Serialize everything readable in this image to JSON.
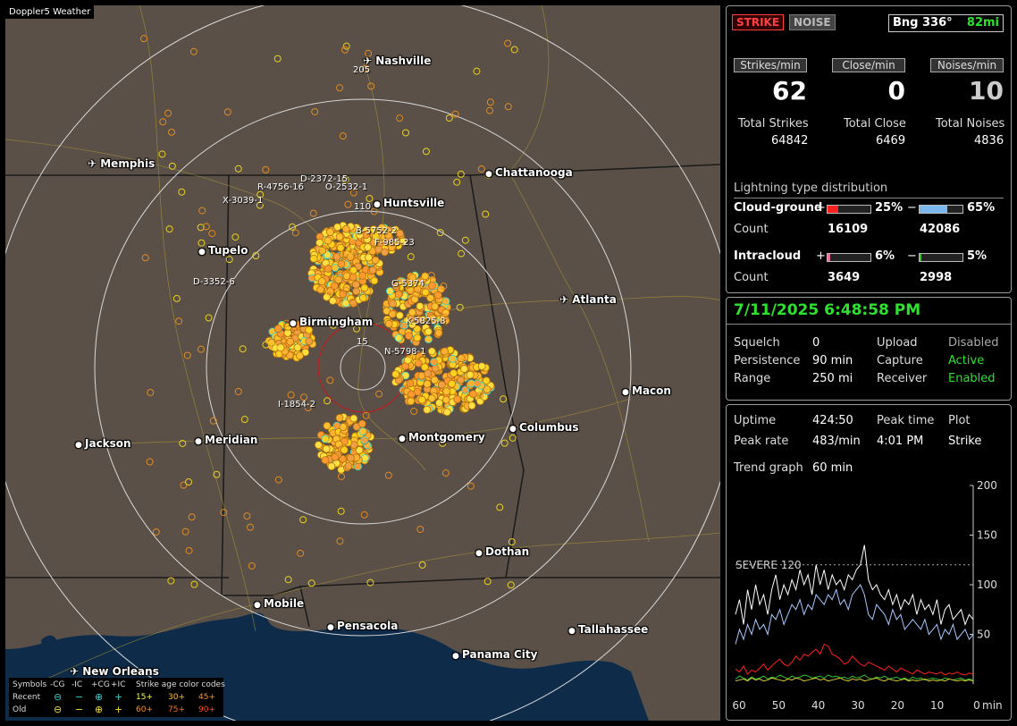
{
  "map": {
    "title": "Doppler5 Weather",
    "cities": [
      {
        "name": "Nashville",
        "airport": true
      },
      {
        "name": "Memphis",
        "airport": true
      },
      {
        "name": "Chattanooga",
        "airport": false
      },
      {
        "name": "Huntsville",
        "airport": false
      },
      {
        "name": "Tupelo",
        "airport": false
      },
      {
        "name": "Birmingham",
        "airport": false
      },
      {
        "name": "Atlanta",
        "airport": true
      },
      {
        "name": "Macon",
        "airport": false
      },
      {
        "name": "Jackson",
        "airport": false
      },
      {
        "name": "Meridian",
        "airport": false
      },
      {
        "name": "Montgomery",
        "airport": false
      },
      {
        "name": "Columbus",
        "airport": false
      },
      {
        "name": "Dothan",
        "airport": false
      },
      {
        "name": "Mobile",
        "airport": false
      },
      {
        "name": "Pensacola",
        "airport": false
      },
      {
        "name": "Tallahassee",
        "airport": false
      },
      {
        "name": "Panama City",
        "airport": false
      },
      {
        "name": "New Orleans",
        "airport": true
      }
    ],
    "storm_labels": [
      "D-2372-15",
      "R-4756-16",
      "O-2532-1",
      "X-3039-1",
      "B-5752-2",
      "F-985-23",
      "D-3352-6",
      "G-5374",
      "K-5825-8",
      "N-5798-1",
      "I-1854-2"
    ],
    "range_labels": [
      "205",
      "110",
      "15"
    ],
    "legend": {
      "symbols_title": "Symbols",
      "cg_neg": "-CG",
      "ic_neg": "-IC",
      "cg_pos": "+CG",
      "ic_pos": "+IC",
      "age_title": "Strike age color codes",
      "recent": "Recent",
      "old": "Old",
      "ages_recent": [
        "15+",
        "30+",
        "45+"
      ],
      "ages_old": [
        "60+",
        "75+",
        "90+"
      ]
    },
    "colors": {
      "land": "#5a5048",
      "water": "#0e2c4a",
      "ring": "#d8d8d8",
      "close_ring": "#c8181c"
    }
  },
  "top": {
    "strike_btn": "STRIKE",
    "noise_btn": "NOISE",
    "bearing_label": "Bng 336°",
    "bearing_dist": "82mi",
    "headers": [
      "Strikes/min",
      "Close/min",
      "Noises/min"
    ],
    "rates": [
      "62",
      "0",
      "10"
    ],
    "total_labels": [
      "Total Strikes",
      "Total Close",
      "Total Noises"
    ],
    "totals": [
      "64842",
      "6469",
      "4836"
    ],
    "dist_title": "Lightning type distribution",
    "cg_label": "Cloud-ground",
    "ic_label": "Intracloud",
    "count_label": "Count",
    "cg_pos_pct": "25%",
    "cg_neg_pct": "65%",
    "ic_pos_pct": "6%",
    "ic_neg_pct": "5%",
    "cg_pos_frac": 0.25,
    "cg_neg_frac": 0.65,
    "ic_pos_frac": 0.06,
    "ic_neg_frac": 0.05,
    "cg_pos_count": "16109",
    "cg_neg_count": "42086",
    "ic_pos_count": "3649",
    "ic_neg_count": "2998",
    "plus": "+",
    "minus": "−"
  },
  "status": {
    "datetime": "7/11/2025 6:48:58 PM",
    "squelch_label": "Squelch",
    "squelch": "0",
    "persistence_label": "Persistence",
    "persistence": "90 min",
    "range_label": "Range",
    "range": "250 mi",
    "upload_label": "Upload",
    "upload": "Disabled",
    "capture_label": "Capture",
    "capture": "Active",
    "receiver_label": "Receiver",
    "receiver": "Enabled"
  },
  "trend": {
    "uptime_label": "Uptime",
    "uptime": "424:50",
    "peak_time_label": "Peak time",
    "peak_time": "4:01 PM",
    "plot_label": "Plot",
    "plot": "Strike",
    "peak_rate_label": "Peak rate",
    "peak_rate": "483/min",
    "trend_label": "Trend graph",
    "trend_value": "60 min",
    "severe_label": "SEVERE 120",
    "chart_data": {
      "type": "line",
      "x_unit": "min",
      "x_ticks": [
        "60",
        "50",
        "40",
        "30",
        "20",
        "10",
        "0"
      ],
      "y_ticks": [
        "200",
        "150",
        "100",
        "50"
      ],
      "ylim": [
        0,
        200
      ],
      "severe_threshold": 120,
      "series": [
        {
          "color": "#ffffff",
          "values": [
            70,
            85,
            60,
            95,
            75,
            100,
            80,
            90,
            70,
            95,
            110,
            85,
            100,
            90,
            105,
            95,
            115,
            100,
            110,
            90,
            120,
            100,
            115,
            95,
            110,
            100,
            105,
            95,
            110,
            105,
            115,
            120,
            140,
            105,
            95,
            100,
            90,
            85,
            95,
            80,
            90,
            75,
            85,
            80,
            90,
            70,
            85,
            75,
            80,
            70,
            85,
            60,
            75,
            80,
            65,
            70,
            75,
            60,
            70,
            65
          ]
        },
        {
          "color": "#a8c8ff",
          "values": [
            40,
            55,
            45,
            60,
            50,
            65,
            55,
            60,
            50,
            70,
            65,
            75,
            60,
            70,
            80,
            75,
            85,
            70,
            80,
            75,
            90,
            85,
            80,
            90,
            85,
            95,
            80,
            85,
            75,
            90,
            95,
            100,
            90,
            70,
            65,
            80,
            75,
            70,
            60,
            75,
            65,
            70,
            55,
            60,
            65,
            60,
            55,
            65,
            50,
            55,
            60,
            45,
            55,
            50,
            60,
            45,
            50,
            55,
            45,
            50
          ]
        },
        {
          "color": "#ff2020",
          "values": [
            15,
            12,
            18,
            10,
            14,
            12,
            16,
            20,
            14,
            18,
            22,
            25,
            20,
            18,
            22,
            28,
            24,
            30,
            28,
            32,
            35,
            30,
            40,
            38,
            30,
            28,
            25,
            20,
            22,
            28,
            24,
            20,
            18,
            22,
            20,
            18,
            16,
            14,
            18,
            15,
            12,
            16,
            14,
            12,
            10,
            14,
            12,
            10,
            12,
            11,
            10,
            12,
            9,
            11,
            10,
            12,
            10,
            9,
            11,
            10
          ]
        },
        {
          "color": "#30c030",
          "values": [
            5,
            8,
            6,
            4,
            7,
            5,
            6,
            8,
            5,
            7,
            6,
            9,
            7,
            5,
            8,
            6,
            7,
            9,
            8,
            6,
            7,
            8,
            6,
            9,
            7,
            8,
            6,
            7,
            5,
            8,
            6,
            7,
            9,
            6,
            5,
            7,
            6,
            8,
            5,
            6,
            7,
            5,
            6,
            4,
            7,
            5,
            6,
            4,
            5,
            6,
            5,
            4,
            6,
            5,
            4,
            5,
            6,
            4,
            5,
            4
          ]
        },
        {
          "color": "#d8c830",
          "values": [
            3,
            4,
            5,
            3,
            6,
            4,
            5,
            3,
            4,
            6,
            5,
            4,
            3,
            5,
            4,
            6,
            5,
            3,
            4,
            5,
            6,
            4,
            5,
            3,
            4,
            5,
            6,
            4,
            3,
            5,
            4,
            5,
            3,
            4,
            5,
            6,
            4,
            3,
            5,
            4,
            3,
            4,
            5,
            3,
            4,
            3,
            4,
            5,
            3,
            4,
            3,
            4,
            3,
            5,
            4,
            3,
            4,
            3,
            4,
            3
          ]
        }
      ]
    }
  }
}
